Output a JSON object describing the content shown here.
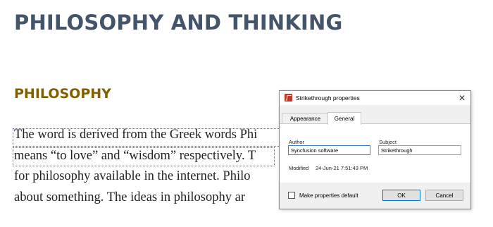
{
  "document": {
    "heading": "PHILOSOPHY AND THINKING",
    "subheading": "PHILOSOPHY",
    "paragraph_lines": [
      "The word is derived from the Greek words Phi",
      "means “to love” and “wisdom” respectively. T",
      "for philosophy available in the internet. Philo",
      "about something. The ideas in philosophy ar"
    ]
  },
  "dialog": {
    "title": "Strikethrough properties",
    "tabs": [
      {
        "label": "Appearance"
      },
      {
        "label": "General"
      }
    ],
    "active_tab": "General",
    "author_label": "Author",
    "author_value": "Syncfusion software",
    "subject_label": "Subject",
    "subject_value": "Strikethrough",
    "modified_label": "Modified",
    "modified_value": "24-Jun-21 7:51:43 PM",
    "make_default_label": "Make properties default",
    "make_default_checked": false,
    "ok_label": "OK",
    "cancel_label": "Cancel"
  }
}
